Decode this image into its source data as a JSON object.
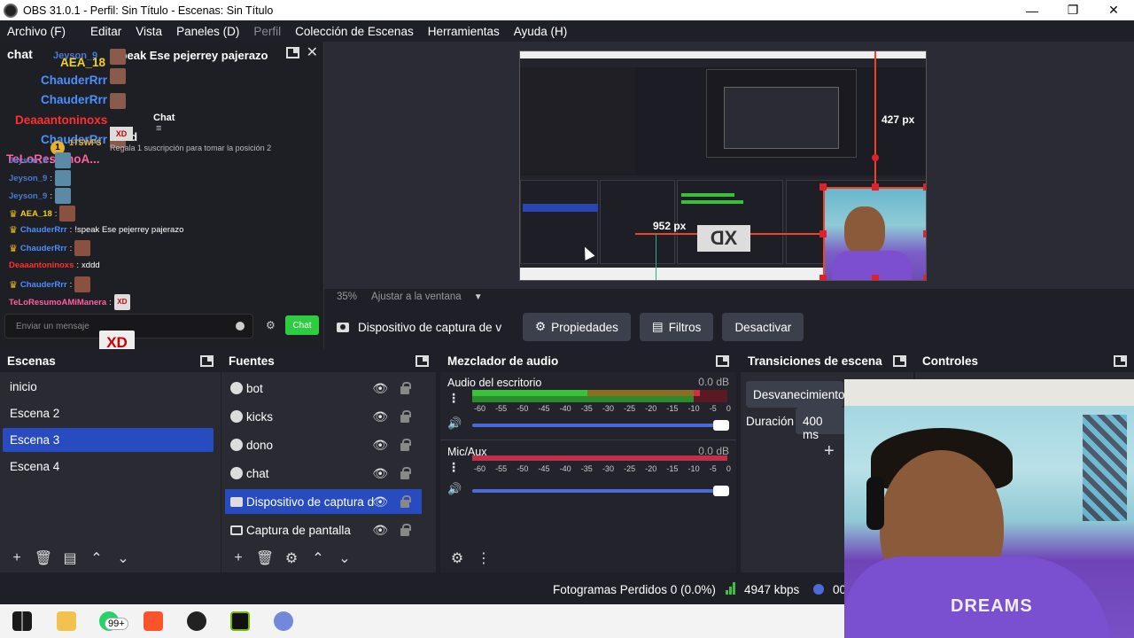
{
  "window": {
    "title": "OBS 31.0.1 - Perfil: Sin Título - Escenas: Sin Título",
    "minimize": "—",
    "maximize": "❐",
    "close": "✕"
  },
  "menu": {
    "items": [
      "Archivo (F)",
      "Editar",
      "Vista",
      "Paneles (D)",
      "Perfil",
      "Colección de Escenas",
      "Herramientas",
      "Ayuda (H)"
    ]
  },
  "chat": {
    "title": "chat",
    "pinned_text": "!speak Ese pejerrey pajerazo",
    "tab_label": "Chat",
    "pinned_users": [
      {
        "name": "Jeyson_9",
        "color": "#4a7ad0"
      },
      {
        "name": "AEA_18",
        "color": "#f0d020"
      },
      {
        "name": "ChauderRrr",
        "color": "#4a90ff"
      },
      {
        "name": "ChauderRrr",
        "color": "#4a90ff"
      },
      {
        "name": "Deaaantoninoxs",
        "color": "#ff3030"
      },
      {
        "name": "ChauderRrr",
        "color": "#4a90ff"
      },
      {
        "name": "TeLoResumoA...",
        "color": "#ff60a0"
      }
    ],
    "pinned_message": "xddd",
    "gift_badge": "1",
    "gift_user": "1TSWFS",
    "gift_text": "Regala 1 suscripción para tomar la posición 2",
    "lines": [
      {
        "user": "Jeyson_9",
        "sep": ":",
        "message": "",
        "color": "#4a7ad0",
        "crown": false
      },
      {
        "user": "Jeyson_9",
        "sep": ":",
        "message": "",
        "color": "#4a7ad0",
        "crown": false
      },
      {
        "user": "Jeyson_9",
        "sep": ":",
        "message": "",
        "color": "#4a7ad0",
        "crown": false
      },
      {
        "user": "AEA_18",
        "sep": ":",
        "message": "",
        "color": "#f0d020",
        "crown": true
      },
      {
        "user": "ChauderRrr",
        "sep": ":",
        "message": "!speak Ese pejerrey pajerazo",
        "color": "#4a90ff",
        "crown": true
      },
      {
        "user": "ChauderRrr",
        "sep": ":",
        "message": "",
        "color": "#4a90ff",
        "crown": true
      },
      {
        "user": "Deaaantoninoxs",
        "sep": ":",
        "message": "xddd",
        "color": "#ff3030",
        "crown": false
      },
      {
        "user": "ChauderRrr",
        "sep": ":",
        "message": "",
        "color": "#4a90ff",
        "crown": true
      },
      {
        "user": "TeLoResumoAMiManera",
        "sep": ":",
        "message": "",
        "color": "#ff60a0",
        "crown": false
      }
    ],
    "input_placeholder": "Enviar un mensaje",
    "send_label": "Chat",
    "sticker": "XD"
  },
  "preview": {
    "zoom": "35%",
    "fit_label": "Ajustar a la ventana",
    "height_label": "427 px",
    "width_label": "952 px",
    "overlay_text": "XD",
    "shirt_text": "DREAMS"
  },
  "context": {
    "source_name": "Dispositivo de captura de v",
    "properties": "Propiedades",
    "filters": "Filtros",
    "deactivate": "Desactivar"
  },
  "scenes": {
    "title": "Escenas",
    "items": [
      "inicio",
      "Escena 2",
      "Escena 3",
      "Escena 4"
    ],
    "selected_index": 2
  },
  "sources": {
    "title": "Fuentes",
    "items": [
      {
        "name": "bot",
        "icon": "browser-icon"
      },
      {
        "name": "kicks",
        "icon": "browser-icon"
      },
      {
        "name": "dono",
        "icon": "browser-icon"
      },
      {
        "name": "chat",
        "icon": "browser-icon"
      },
      {
        "name": "Dispositivo de captura d",
        "icon": "camera-icon"
      },
      {
        "name": "Captura de pantalla",
        "icon": "monitor-icon"
      }
    ],
    "selected_index": 4
  },
  "mixer": {
    "title": "Mezclador de audio",
    "channels": [
      {
        "name": "Audio del escritorio",
        "db": "0.0 dB",
        "level": 0.88
      },
      {
        "name": "Mic/Aux",
        "db": "0.0 dB",
        "level": 0.0
      }
    ],
    "scale": [
      "-60",
      "-55",
      "-50",
      "-45",
      "-40",
      "-35",
      "-30",
      "-25",
      "-20",
      "-15",
      "-10",
      "-5",
      "0"
    ]
  },
  "transitions": {
    "title": "Transiciones de escena",
    "selected": "Desvanecimiento",
    "duration_label": "Duración",
    "duration_value": "400 ms"
  },
  "controls": {
    "title": "Controles"
  },
  "status": {
    "dropped": "Fotogramas Perdidos 0 (0.0%)",
    "bitrate": "4947 kbps",
    "time": "00"
  },
  "taskbar": {
    "badge": "99+"
  },
  "colors": {
    "accent": "#284bc0",
    "background": "#1f1f27",
    "panel": "#2a2a33",
    "chat_green": "#2ecc40"
  }
}
